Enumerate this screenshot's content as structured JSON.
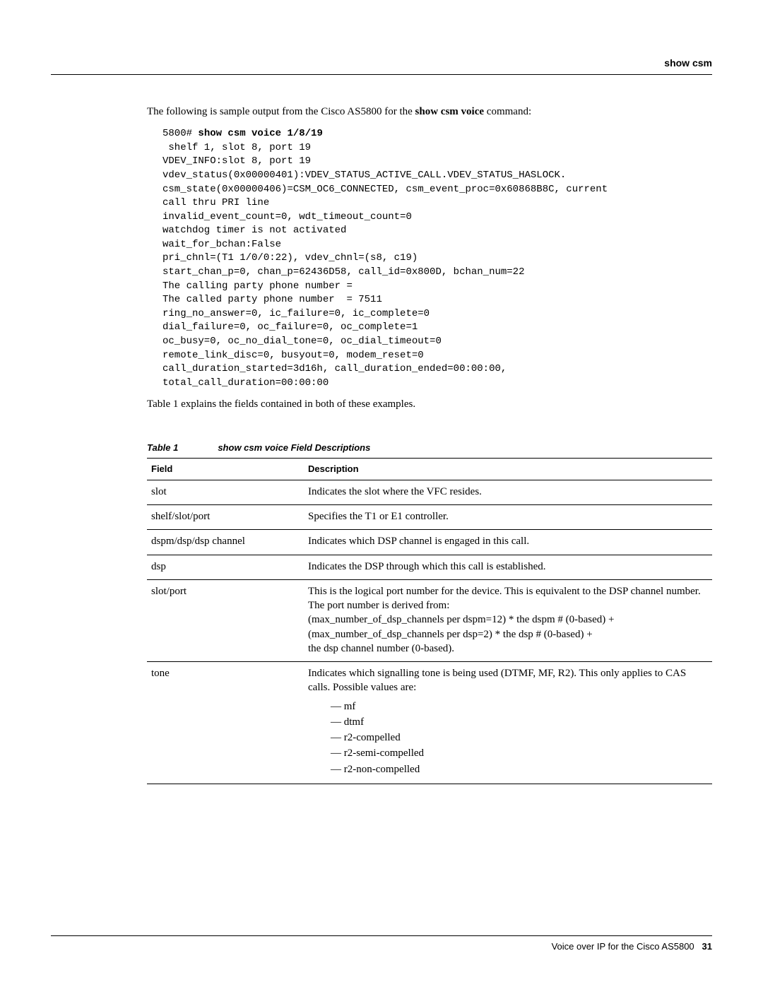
{
  "header": {
    "title": "show csm"
  },
  "intro": {
    "pre": "The following is sample output from the Cisco AS5800 for the ",
    "cmd": "show csm voice",
    "post": " command:"
  },
  "sample": {
    "prompt": "5800# ",
    "command": "show csm voice 1/8/19",
    "lines": [
      " shelf 1, slot 8, port 19",
      "VDEV_INFO:slot 8, port 19",
      "vdev_status(0x00000401):VDEV_STATUS_ACTIVE_CALL.VDEV_STATUS_HASLOCK.",
      "csm_state(0x00000406)=CSM_OC6_CONNECTED, csm_event_proc=0x60868B8C, current",
      "call thru PRI line",
      "invalid_event_count=0, wdt_timeout_count=0",
      "watchdog timer is not activated",
      "wait_for_bchan:False",
      "pri_chnl=(T1 1/0/0:22), vdev_chnl=(s8, c19)",
      "start_chan_p=0, chan_p=62436D58, call_id=0x800D, bchan_num=22",
      "The calling party phone number =",
      "The called party phone number  = 7511",
      "ring_no_answer=0, ic_failure=0, ic_complete=0",
      "dial_failure=0, oc_failure=0, oc_complete=1",
      "oc_busy=0, oc_no_dial_tone=0, oc_dial_timeout=0",
      "remote_link_disc=0, busyout=0, modem_reset=0",
      "call_duration_started=3d16h, call_duration_ended=00:00:00,",
      "total_call_duration=00:00:00"
    ]
  },
  "after_pre": "Table 1 explains the fields contained in both of these examples.",
  "table": {
    "caption_id": "Table 1",
    "caption_title": "show csm voice Field Descriptions",
    "h_field": "Field",
    "h_desc": "Description",
    "rows": [
      {
        "field": "slot",
        "desc": "Indicates the slot where the VFC resides."
      },
      {
        "field": "shelf/slot/port",
        "desc": "Specifies the T1 or E1 controller."
      },
      {
        "field": "dspm/dsp/dsp channel",
        "desc": "Indicates which DSP channel is engaged in this call."
      },
      {
        "field": "dsp",
        "desc": "Indicates the DSP through which this call is established."
      },
      {
        "field": "slot/port",
        "desc": "This is the logical port number for the device. This is equivalent to the DSP channel number. The port number is derived from:\n(max_number_of_dsp_channels per dspm=12) * the dspm # (0-based) +\n(max_number_of_dsp_channels per dsp=2) * the dsp # (0-based) +\nthe dsp channel number (0-based)."
      },
      {
        "field": "tone",
        "desc": "Indicates which signalling tone is being used (DTMF, MF, R2). This only applies to CAS calls. Possible values are:",
        "list": [
          "mf",
          "dtmf",
          "r2-compelled",
          "r2-semi-compelled",
          "r2-non-compelled"
        ]
      }
    ]
  },
  "footer": {
    "title": "Voice over IP for the Cisco AS5800",
    "page": "31"
  }
}
